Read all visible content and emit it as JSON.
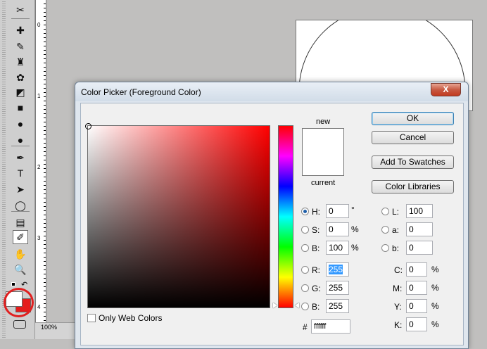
{
  "app": {
    "ruler_marks": [
      "0",
      "1",
      "2",
      "3",
      "4"
    ],
    "zoom": "100%"
  },
  "toolbar": {
    "tools": [
      {
        "name": "slice-tool-icon",
        "glyph": "✂",
        "active": false
      },
      {
        "name": "spot-healing-icon",
        "glyph": "✚",
        "active": false
      },
      {
        "name": "brush-icon",
        "glyph": "✎",
        "active": false
      },
      {
        "name": "stamp-icon",
        "glyph": "♜",
        "active": false
      },
      {
        "name": "history-brush-icon",
        "glyph": "✿",
        "active": false
      },
      {
        "name": "eraser-icon",
        "glyph": "◩",
        "active": false
      },
      {
        "name": "gradient-icon",
        "glyph": "■",
        "active": false
      },
      {
        "name": "blur-icon",
        "glyph": "●",
        "active": false
      },
      {
        "name": "dodge-icon",
        "glyph": "●",
        "active": false
      },
      {
        "name": "pen-icon",
        "glyph": "✒",
        "active": false
      },
      {
        "name": "type-icon",
        "glyph": "T",
        "active": false
      },
      {
        "name": "path-selection-icon",
        "glyph": "➤",
        "active": false
      },
      {
        "name": "ellipse-icon",
        "glyph": "◯",
        "active": false
      },
      {
        "name": "notes-icon",
        "glyph": "▤",
        "active": false
      },
      {
        "name": "eyedropper-icon",
        "glyph": "✐",
        "active": true
      },
      {
        "name": "hand-icon",
        "glyph": "✋",
        "active": false
      },
      {
        "name": "zoom-icon",
        "glyph": "🔍",
        "active": false
      }
    ],
    "foreground_color": "#ffffff",
    "background_color": "#e41b1b"
  },
  "dialog": {
    "title": "Color Picker (Foreground Color)",
    "close_label": "X",
    "label_new": "new",
    "label_current": "current",
    "new_color": "#ffffff",
    "current_color": "#ffffff",
    "only_web_colors": "Only Web Colors",
    "buttons": {
      "ok": "OK",
      "cancel": "Cancel",
      "add_to_swatches": "Add To Swatches",
      "color_libraries": "Color Libraries"
    },
    "hsb": {
      "h": {
        "label": "H:",
        "value": "0",
        "unit": "°"
      },
      "s": {
        "label": "S:",
        "value": "0",
        "unit": "%"
      },
      "b": {
        "label": "B:",
        "value": "100",
        "unit": "%"
      }
    },
    "rgb": {
      "r": {
        "label": "R:",
        "value": "255"
      },
      "g": {
        "label": "G:",
        "value": "255"
      },
      "b": {
        "label": "B:",
        "value": "255"
      }
    },
    "lab": {
      "l": {
        "label": "L:",
        "value": "100"
      },
      "a": {
        "label": "a:",
        "value": "0"
      },
      "b": {
        "label": "b:",
        "value": "0"
      }
    },
    "cmyk": {
      "c": {
        "label": "C:",
        "value": "0",
        "unit": "%"
      },
      "m": {
        "label": "M:",
        "value": "0",
        "unit": "%"
      },
      "y": {
        "label": "Y:",
        "value": "0",
        "unit": "%"
      },
      "k": {
        "label": "K:",
        "value": "0",
        "unit": "%"
      }
    },
    "hex": {
      "label": "#",
      "value": "ffffff"
    }
  }
}
